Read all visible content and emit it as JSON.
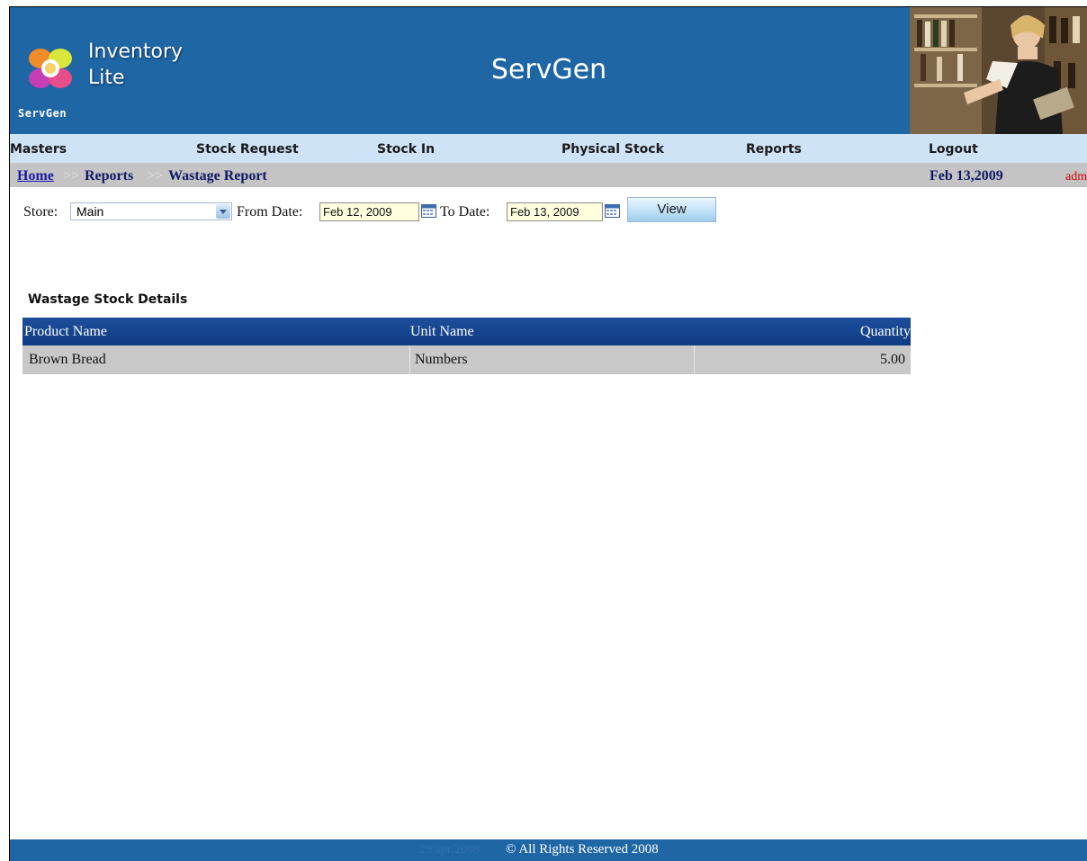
{
  "header": {
    "logo_caption": "ServGen",
    "product_line1": "Inventory",
    "product_line2": "Lite",
    "title": "ServGen"
  },
  "nav": {
    "items": [
      "Masters",
      "Stock Request",
      "Stock In",
      "Physical Stock",
      "Reports",
      "Logout"
    ]
  },
  "breadcrumb": {
    "home": "Home",
    "separator": ">>",
    "reports": "Reports",
    "current": "Wastage Report",
    "date": "Feb 13,2009",
    "user": "adm"
  },
  "filters": {
    "store_label": "Store:",
    "store_value": "Main",
    "from_label": "From Date:",
    "from_value": "Feb 12, 2009",
    "to_label": "To Date:",
    "to_value": "Feb 13, 2009",
    "view_button": "View"
  },
  "report": {
    "section_title": "Wastage Stock Details",
    "columns": [
      "Product Name",
      "Unit Name",
      "Quantity"
    ],
    "rows": [
      [
        "Brown Bread",
        "Numbers",
        "5.00"
      ]
    ]
  },
  "footer": {
    "date_text": "29 apr 2008",
    "copyright": "© All Rights Reserved 2008"
  },
  "colors": {
    "header_blue": "#1f66a4",
    "nav_bg": "#cfe3f7",
    "breadcrumb_bg": "#c4c4c4",
    "table_header": "#0f3b82",
    "row_bg": "#c8c8c8",
    "user_red": "#d60000"
  }
}
